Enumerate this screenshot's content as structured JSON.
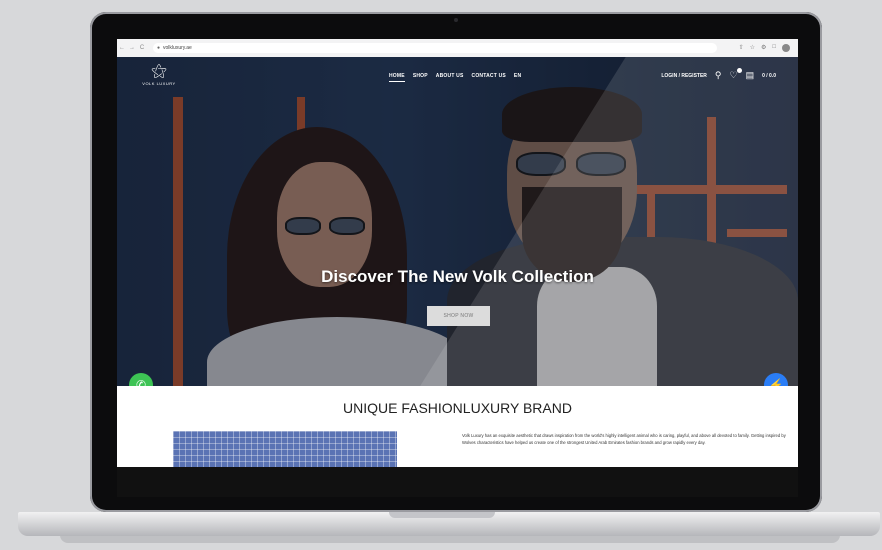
{
  "browser": {
    "url": "volkluxury.ae",
    "nav": [
      "←",
      "→",
      "C"
    ]
  },
  "site": {
    "logo_text": "VOLK LUXURY",
    "nav": [
      "HOME",
      "SHOP",
      "ABOUT US",
      "CONTACT US",
      "EN"
    ],
    "login": "LOGIN / REGISTER",
    "cart_total": "0 / 0.0"
  },
  "hero": {
    "title": "Discover The New Volk Collection",
    "cta": "SHOP NOW"
  },
  "section": {
    "title": "UNIQUE FASHIONLUXURY BRAND",
    "body": "Volk Luxury has an exquisite aesthetic that draws inspiration from the world's highly intelligent animal who is caring, playful, and above all devoted to family. Getting inspired by Wolves characteristics have helped us create one of the strongest United Arab Emirates fashion brands and grow rapidly every day."
  },
  "colors": {
    "whatsapp": "#3dc354",
    "messenger": "#2a7df6",
    "hero_pipe": "#b7542e"
  },
  "icons": [
    "search-icon",
    "heart-icon",
    "cart-icon",
    "whatsapp-icon",
    "messenger-icon",
    "wolf-logo"
  ]
}
